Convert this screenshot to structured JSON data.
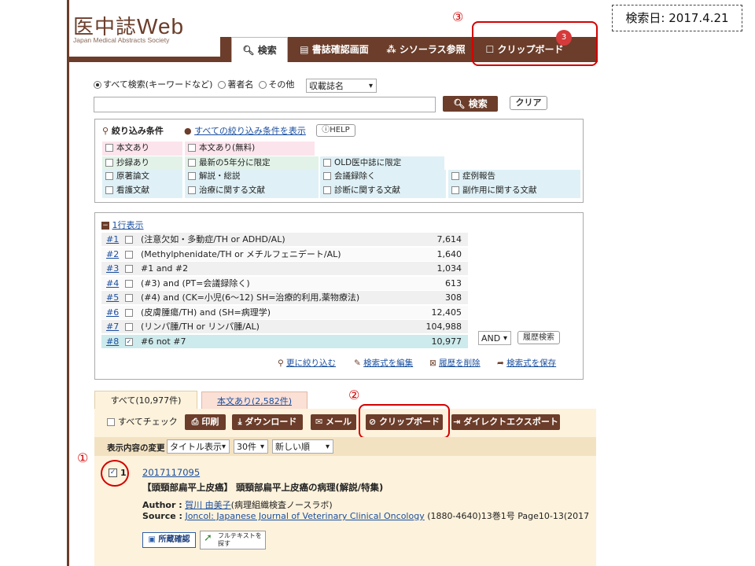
{
  "logo": {
    "title_jp": "医中誌",
    "title_en": "Web",
    "subtitle": "Japan Medical Abstracts Society"
  },
  "search_date": "検索日: 2017.4.21",
  "annotations": {
    "one": "①",
    "two": "②",
    "three": "③"
  },
  "nav": {
    "tabs": [
      {
        "label": "検索",
        "icon": "search-icon"
      },
      {
        "label": "書誌確認画面",
        "icon": "document-icon"
      },
      {
        "label": "シソーラス参照",
        "icon": "thesaurus-icon"
      },
      {
        "label": "クリップボード",
        "icon": "clipboard-icon"
      }
    ],
    "clipboard_count": "3"
  },
  "search": {
    "scope_options": [
      "すべて検索(キーワードなど)",
      "著者名",
      "その他"
    ],
    "field_select": "収載誌名",
    "query": "",
    "search_button": "検索",
    "clear_button": "クリア"
  },
  "filters": {
    "title": "絞り込み条件",
    "show_all": "すべての絞り込み条件を表示",
    "help": "HELP",
    "pink": [
      "本文あり",
      "本文あり(無料)"
    ],
    "green": [
      "抄録あり",
      "最新の5年分に限定",
      "OLD医中誌に限定"
    ],
    "blue_row1": [
      "原著論文",
      "解説・総説",
      "会議録除く",
      "症例報告"
    ],
    "blue_row2": [
      "看護文献",
      "治療に関する文献",
      "診断に関する文献",
      "副作用に関する文献"
    ]
  },
  "history": {
    "toggle": "1行表示",
    "rows": [
      {
        "num": "#1",
        "query": "(注意欠如・多動症/TH or ADHD/AL)",
        "count": "7,614"
      },
      {
        "num": "#2",
        "query": "(Methylphenidate/TH or メチルフェニデート/AL)",
        "count": "1,640"
      },
      {
        "num": "#3",
        "query": "#1 and #2",
        "count": "1,034"
      },
      {
        "num": "#4",
        "query": "(#3) and (PT=会議録除く)",
        "count": "613"
      },
      {
        "num": "#5",
        "query": "(#4) and (CK=小児(6～12) SH=治療的利用,薬物療法)",
        "count": "308"
      },
      {
        "num": "#6",
        "query": "(皮膚腫瘍/TH) and (SH=病理学)",
        "count": "12,405"
      },
      {
        "num": "#7",
        "query": "(リンパ腫/TH or リンパ腫/AL)",
        "count": "104,988"
      },
      {
        "num": "#8",
        "query": "#6 not #7",
        "count": "10,977"
      }
    ],
    "operator": "AND",
    "history_search": "履歴検索",
    "actions": [
      "更に絞り込む",
      "検索式を編集",
      "履歴を削除",
      "検索式を保存"
    ]
  },
  "results": {
    "tabs": [
      "すべて(10,977件)",
      "本文あり(2,582件)"
    ],
    "check_all": "すべてチェック",
    "buttons": [
      "印刷",
      "ダウンロード",
      "メール",
      "クリップボード",
      "ダイレクトエクスポート"
    ],
    "display_label": "表示内容の変更",
    "display_selects": [
      "タイトル表示",
      "30件",
      "新しい順"
    ],
    "item": {
      "index": "1",
      "id": "2017117095",
      "title": "【頭頸部扁平上皮癌】 頭頸部扁平上皮癌の病理(解説/特集)",
      "author_label": "Author :",
      "author": "賀川 由美子",
      "author_affil": "(病理組織検査ノースラボ)",
      "source_label": "Source :",
      "source_link": "Joncol: Japanese Journal of Veterinary Clinical Oncology",
      "source_rest": "(1880-4640)13巻1号 Page10-13(2017",
      "holdings_button": "所蔵確認",
      "fulltext_button": "フルテキストを探す"
    }
  },
  "colors": {
    "brand": "#6b3d2a",
    "pink": "#fce4ec",
    "green": "#e2f2e8",
    "blue": "#dff1f6",
    "result_bg": "#fdf2dc",
    "accent_red": "#d40000"
  }
}
